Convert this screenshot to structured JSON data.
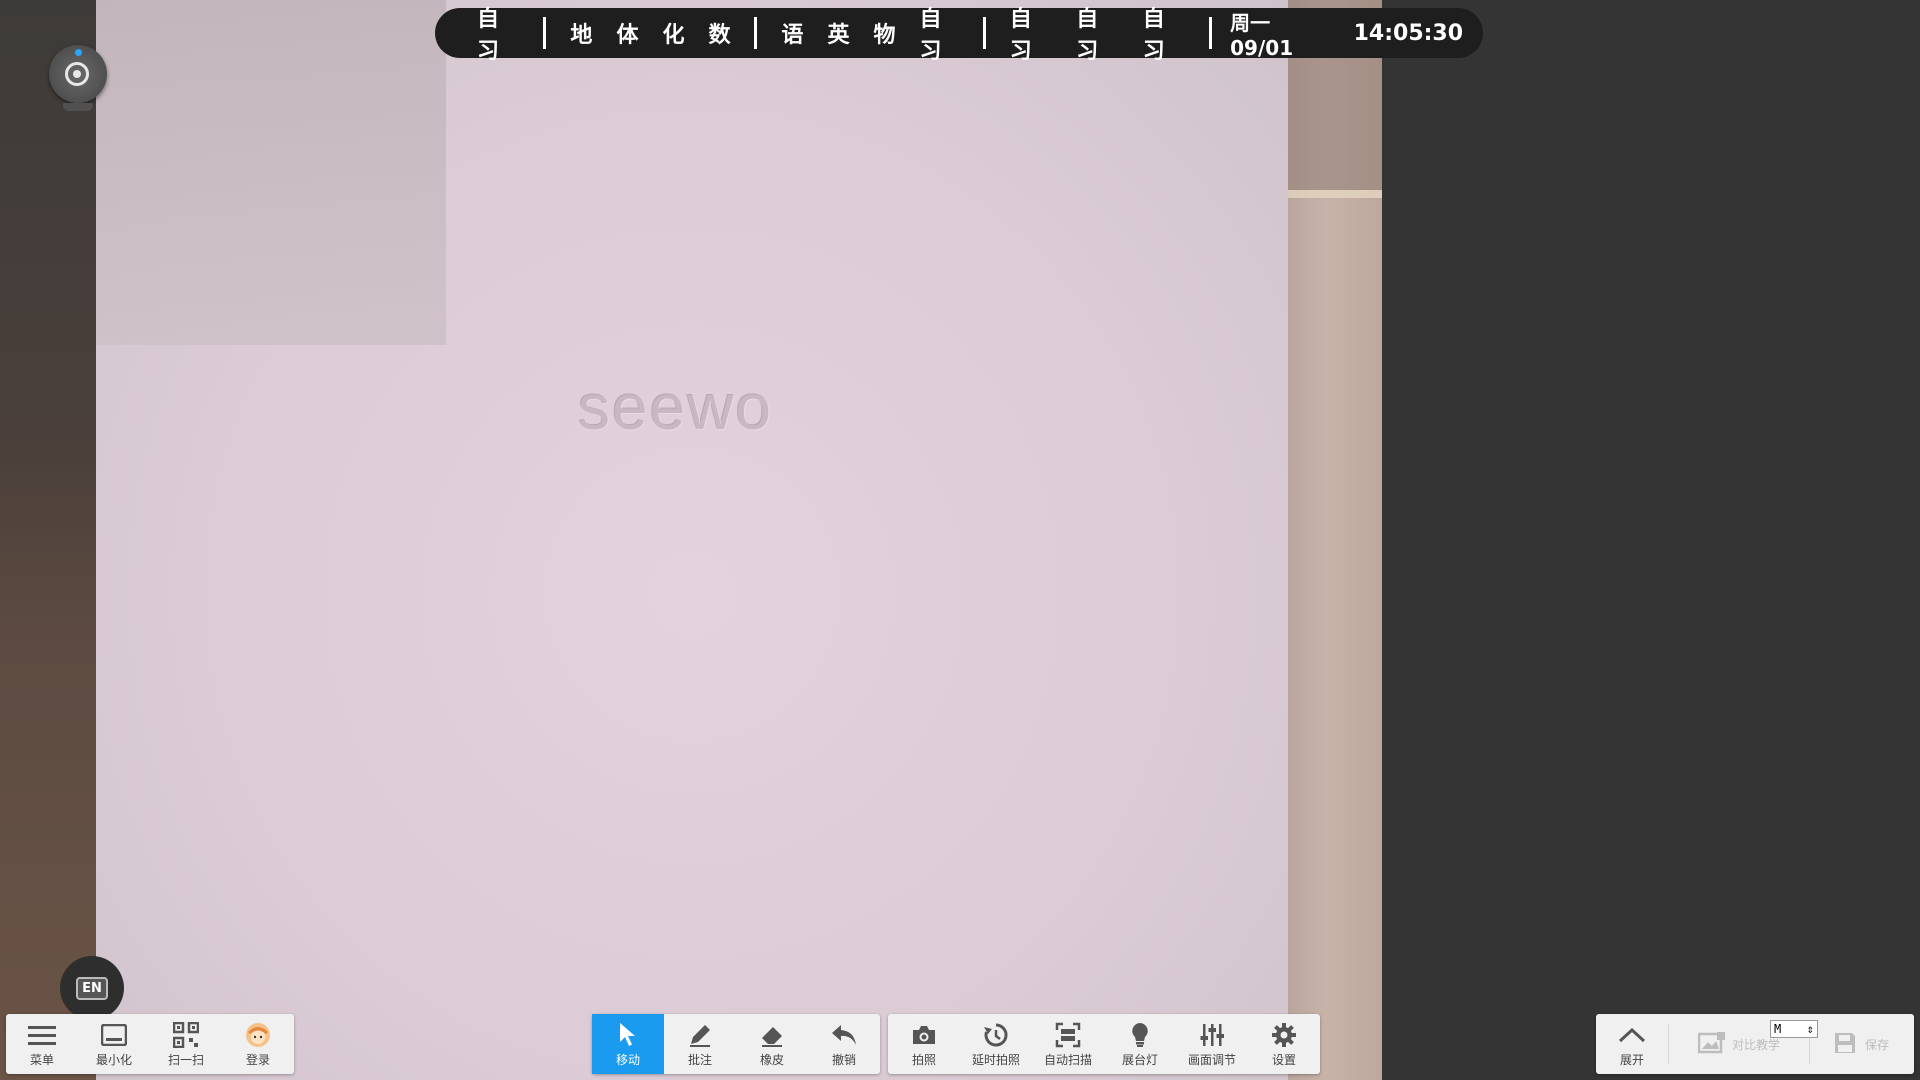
{
  "schedule": {
    "groups": [
      [
        "自习"
      ],
      [
        "地",
        "体",
        "化",
        "数"
      ],
      [
        "语",
        "英",
        "物",
        "自习"
      ],
      [
        "自习",
        "自习",
        "自习"
      ]
    ],
    "day_date": "周一 09/01",
    "time": "14:05:30"
  },
  "camera_feed": {
    "watermark": "seewo"
  },
  "language_button": {
    "label": "EN"
  },
  "left_toolbar": {
    "items": [
      {
        "label": "菜单",
        "icon": "menu-icon"
      },
      {
        "label": "最小化",
        "icon": "minimize-icon"
      },
      {
        "label": "扫一扫",
        "icon": "qr-code-icon"
      },
      {
        "label": "登录",
        "icon": "avatar-icon"
      }
    ]
  },
  "edit_toolbar": {
    "items": [
      {
        "label": "移动",
        "icon": "cursor-icon",
        "active": true
      },
      {
        "label": "批注",
        "icon": "pen-icon"
      },
      {
        "label": "橡皮",
        "icon": "eraser-icon"
      },
      {
        "label": "撤销",
        "icon": "undo-icon"
      }
    ]
  },
  "capture_toolbar": {
    "items": [
      {
        "label": "拍照",
        "icon": "camera-icon"
      },
      {
        "label": "延时拍照",
        "icon": "timer-icon"
      },
      {
        "label": "自动扫描",
        "icon": "scan-icon"
      },
      {
        "label": "展台灯",
        "icon": "lamp-icon"
      },
      {
        "label": "画面调节",
        "icon": "sliders-icon"
      },
      {
        "label": "设置",
        "icon": "gear-icon"
      }
    ]
  },
  "right_toolbar": {
    "expand_label": "展开",
    "compare_label": "对比教学",
    "save_label": "保存",
    "mode_select": "M"
  },
  "colors": {
    "accent": "#1a9bf0",
    "topbar_bg": "#1e1e1e",
    "toolbar_bg": "#f0f0f0"
  }
}
